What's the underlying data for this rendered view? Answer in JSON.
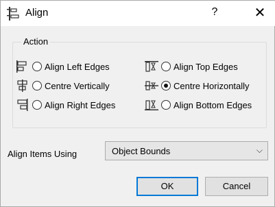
{
  "window": {
    "title": "Align",
    "help_label": "?",
    "close_label": "✕"
  },
  "action": {
    "legend": "Action",
    "options": [
      {
        "label": "Align Left Edges",
        "selected": false,
        "icon": "align-left-icon"
      },
      {
        "label": "Centre Vertically",
        "selected": false,
        "icon": "centre-vertical-icon"
      },
      {
        "label": "Align Right Edges",
        "selected": false,
        "icon": "align-right-icon"
      },
      {
        "label": "Align Top Edges",
        "selected": false,
        "icon": "align-top-icon"
      },
      {
        "label": "Centre Horizontally",
        "selected": true,
        "icon": "centre-horizontal-icon"
      },
      {
        "label": "Align Bottom Edges",
        "selected": false,
        "icon": "align-bottom-icon"
      }
    ]
  },
  "align_using": {
    "label": "Align Items Using",
    "value": "Object Bounds",
    "arrow": "⌵"
  },
  "buttons": {
    "ok": "OK",
    "cancel": "Cancel"
  }
}
